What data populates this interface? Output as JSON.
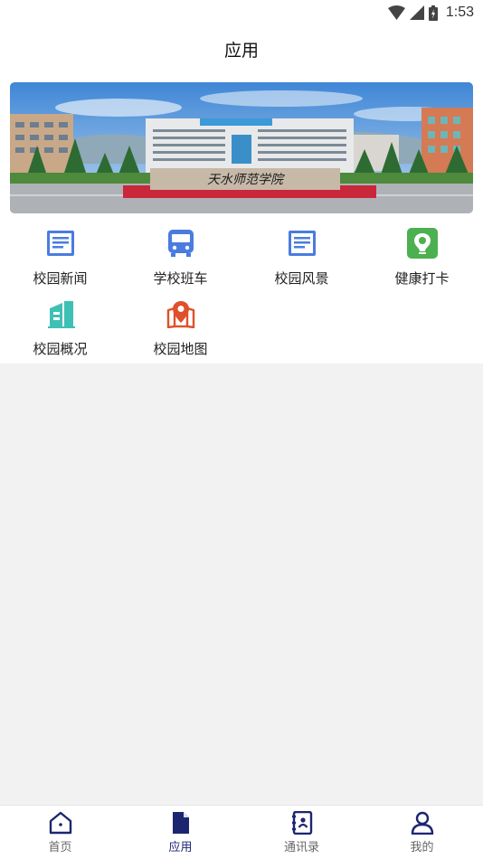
{
  "status_bar": {
    "time": "1:53"
  },
  "header": {
    "title": "应用"
  },
  "banner": {
    "sign_text": "天水师范学院"
  },
  "apps": [
    {
      "label": "校园新闻",
      "icon": "news-icon",
      "color": "#4a7ce0"
    },
    {
      "label": "学校班车",
      "icon": "bus-icon",
      "color": "#4a7ce0"
    },
    {
      "label": "校园风景",
      "icon": "scenery-icon",
      "color": "#4a7ce0"
    },
    {
      "label": "健康打卡",
      "icon": "health-checkin-icon",
      "color": "#4cb050"
    },
    {
      "label": "校园概况",
      "icon": "building-icon",
      "color": "#3fc0b4"
    },
    {
      "label": "校园地图",
      "icon": "map-pin-icon",
      "color": "#e0502a"
    }
  ],
  "tabs": [
    {
      "label": "首页",
      "icon": "home-icon",
      "active": false
    },
    {
      "label": "应用",
      "icon": "document-icon",
      "active": true
    },
    {
      "label": "通讯录",
      "icon": "contacts-icon",
      "active": false
    },
    {
      "label": "我的",
      "icon": "profile-icon",
      "active": false
    }
  ],
  "colors": {
    "tab_active": "#1c2670",
    "tab_inactive": "#666666",
    "page_bg": "#f2f2f2"
  }
}
